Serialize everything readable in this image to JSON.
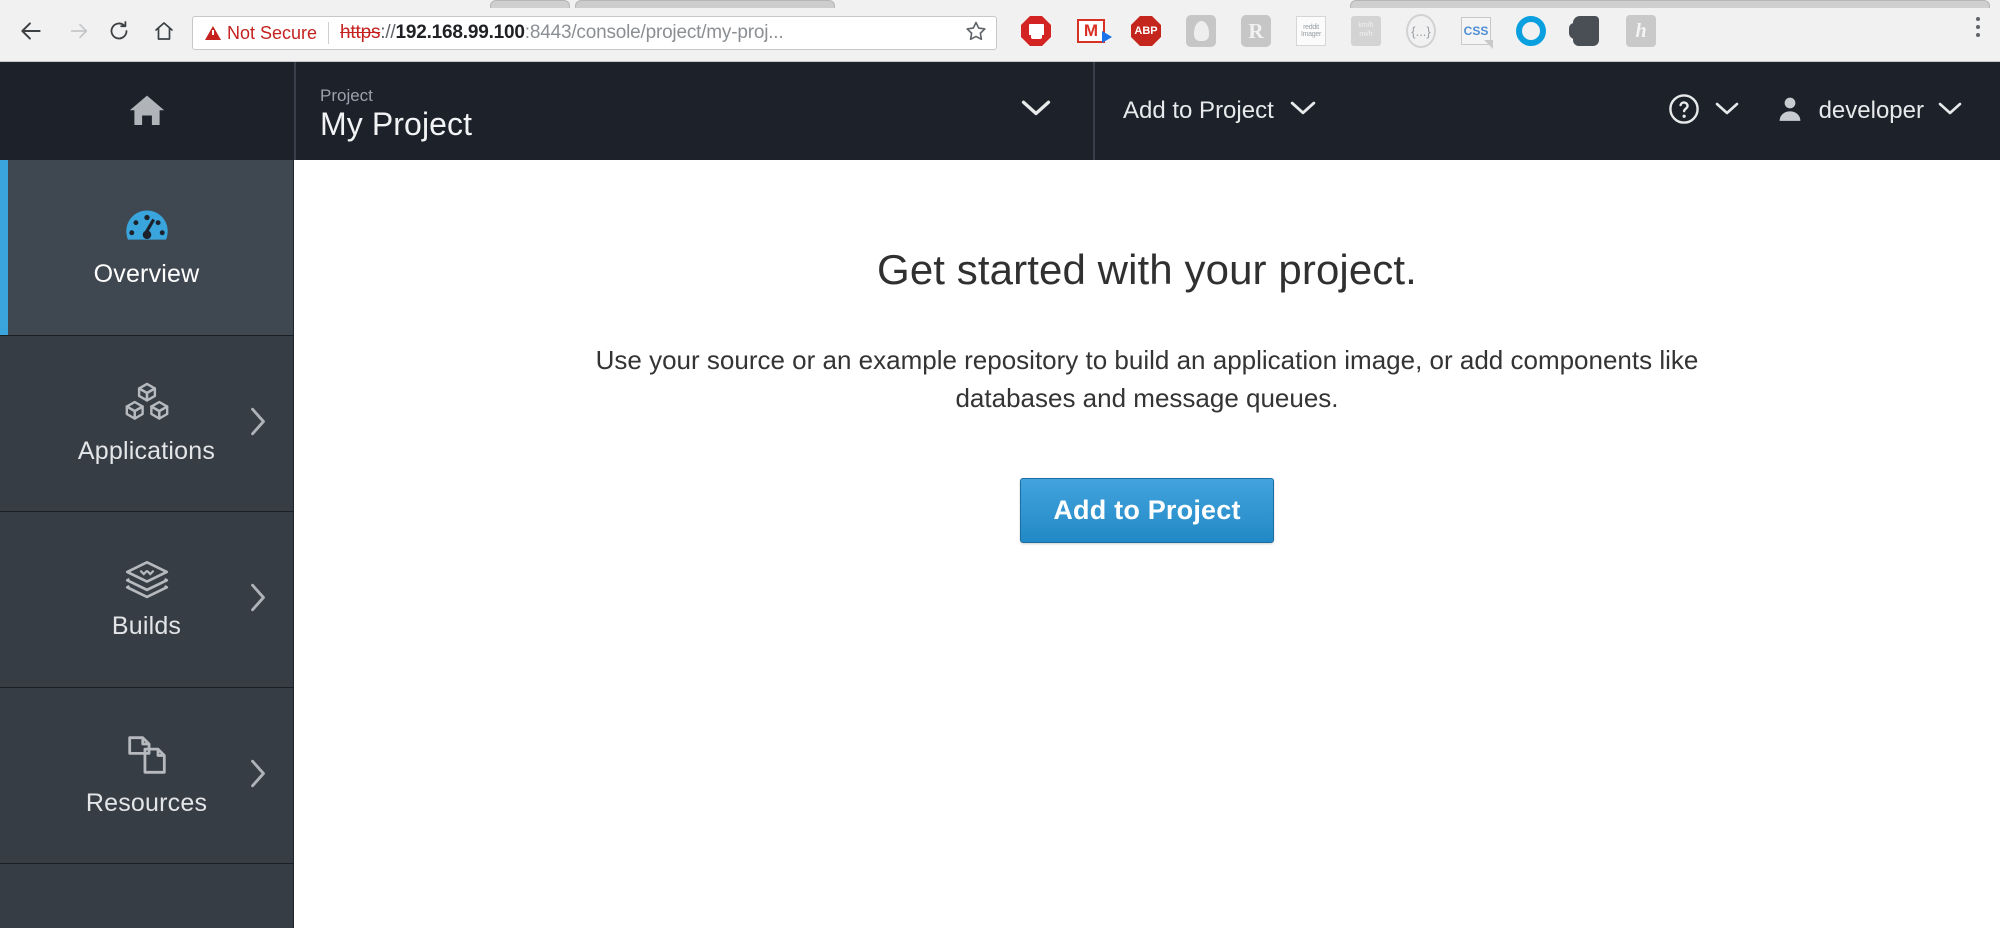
{
  "browser": {
    "security_label": "Not Secure",
    "url": {
      "scheme": "https",
      "separator": "://",
      "host": "192.168.99.100",
      "rest": ":8443/console/project/my-proj..."
    },
    "nav": {
      "back": "back-arrow-icon",
      "forward": "forward-arrow-icon",
      "reload": "reload-icon",
      "home": "home-icon"
    },
    "bookmark_icon": "star-icon",
    "menu_icon": "three-dots-menu-icon",
    "extensions": [
      {
        "name": "adblock-stopsign-icon",
        "label": ""
      },
      {
        "name": "gmail-icon",
        "label": "M"
      },
      {
        "name": "adblock-plus-icon",
        "label": "ABP"
      },
      {
        "name": "ghostery-icon",
        "label": ""
      },
      {
        "name": "reddit-enhancement-icon",
        "label": "R"
      },
      {
        "name": "reddit-imager-icon",
        "label_top": "reddit",
        "label_bottom": "Imager"
      },
      {
        "name": "unit-converter-icon",
        "label_top": "km/h",
        "label_bottom": "mi/h"
      },
      {
        "name": "json-formatter-icon",
        "label": "{...}"
      },
      {
        "name": "css-viewer-icon",
        "label": "CSS"
      },
      {
        "name": "opera-icon",
        "label": ""
      },
      {
        "name": "evernote-clipper-icon",
        "label": ""
      },
      {
        "name": "hypothesis-icon",
        "label": "h"
      }
    ]
  },
  "console": {
    "navbar": {
      "logo_icon": "home-icon",
      "project_selector": {
        "eyebrow": "Project",
        "value": "My Project",
        "caret_icon": "chevron-down-icon"
      },
      "add_to_project": {
        "label": "Add to Project",
        "caret_icon": "chevron-down-icon"
      },
      "help": {
        "icon": "question-circle-icon",
        "caret_icon": "chevron-down-icon"
      },
      "user": {
        "icon": "user-avatar-icon",
        "label": "developer",
        "caret_icon": "chevron-down-icon"
      }
    },
    "sidebar": {
      "items": [
        {
          "label": "Overview",
          "icon": "dashboard-gauge-icon",
          "active": true,
          "has_chevron": false
        },
        {
          "label": "Applications",
          "icon": "cubes-icon",
          "active": false,
          "has_chevron": true
        },
        {
          "label": "Builds",
          "icon": "layers-stack-icon",
          "active": false,
          "has_chevron": true
        },
        {
          "label": "Resources",
          "icon": "copy-documents-icon",
          "active": false,
          "has_chevron": true
        }
      ]
    },
    "main": {
      "title": "Get started with your project.",
      "body": "Use your source or an example repository to build an application image, or add components like databases and message queues.",
      "cta_label": "Add to Project"
    }
  },
  "colors": {
    "accent_blue": "#39a5dc",
    "navbar_dark": "#1d212a",
    "sidebar_dark": "#363d45",
    "sidebar_active": "#3f4750",
    "warning_red": "#c5221f",
    "button_blue_top": "#42a3dd",
    "button_blue_bottom": "#2289c6"
  }
}
